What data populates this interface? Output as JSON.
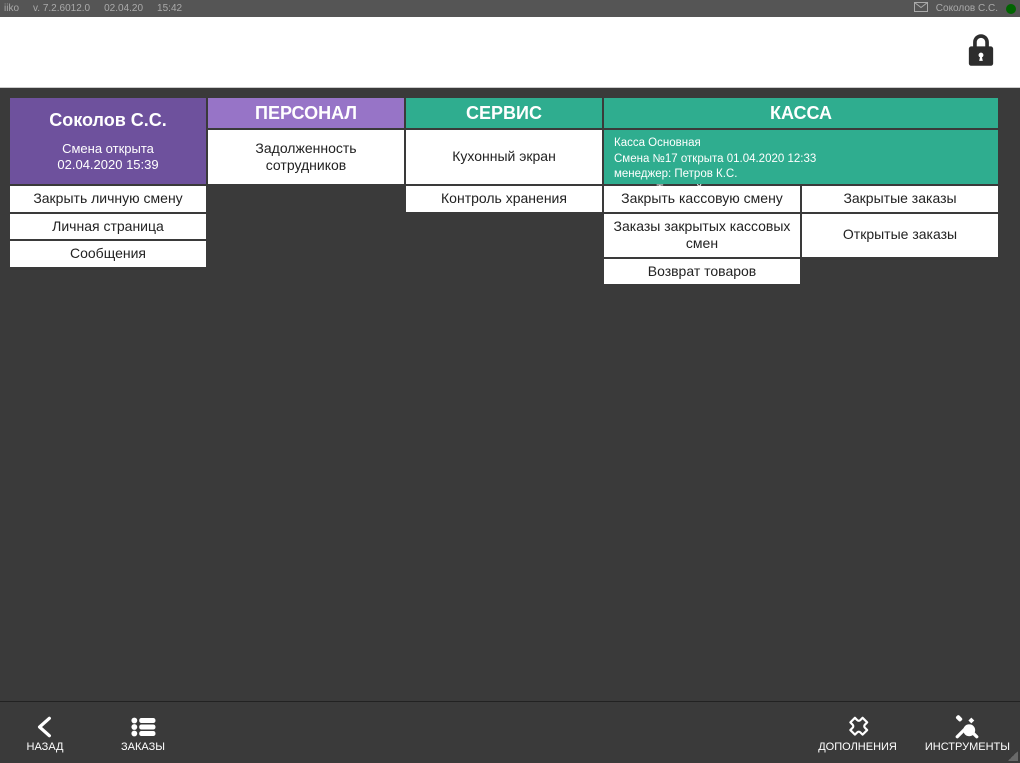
{
  "sysbar": {
    "app": "iiko",
    "version": "v. 7.2.6012.0",
    "date": "02.04.20",
    "time": "15:42",
    "user": "Соколов С.С."
  },
  "colors": {
    "purple_dark": "#6e519d",
    "purple_light": "#9774c7",
    "teal": "#2fad8f",
    "bg_dark": "#3a3a3a"
  },
  "user_panel": {
    "name": "Соколов С.С.",
    "shift_status": "Смена открыта",
    "shift_time": "02.04.2020 15:39",
    "items": [
      "Закрыть личную смену",
      "Личная страница",
      "Сообщения"
    ]
  },
  "staff_panel": {
    "title": "ПЕРСОНАЛ",
    "items": [
      "Задолженность сотрудников"
    ]
  },
  "service_panel": {
    "title": "СЕРВИС",
    "items": [
      "Кухонный экран",
      "Контроль хранения"
    ]
  },
  "cash_panel": {
    "title": "КАССА",
    "info_lines": [
      "Касса Основная",
      "Смена №17 открыта 01.04.2020 12:33",
      "менеджер: Петров К.С.",
      "кассир: Текущий кассир"
    ],
    "left_items": [
      "Закрыть кассовую смену",
      "Заказы закрытых кассовых смен",
      "Возврат товаров"
    ],
    "right_items": [
      "Закрытые заказы",
      "Открытые заказы"
    ]
  },
  "bottombar": {
    "back": "НАЗАД",
    "orders": "ЗАКАЗЫ",
    "addons": "ДОПОЛНЕНИЯ",
    "tools": "ИНСТРУМЕНТЫ"
  }
}
